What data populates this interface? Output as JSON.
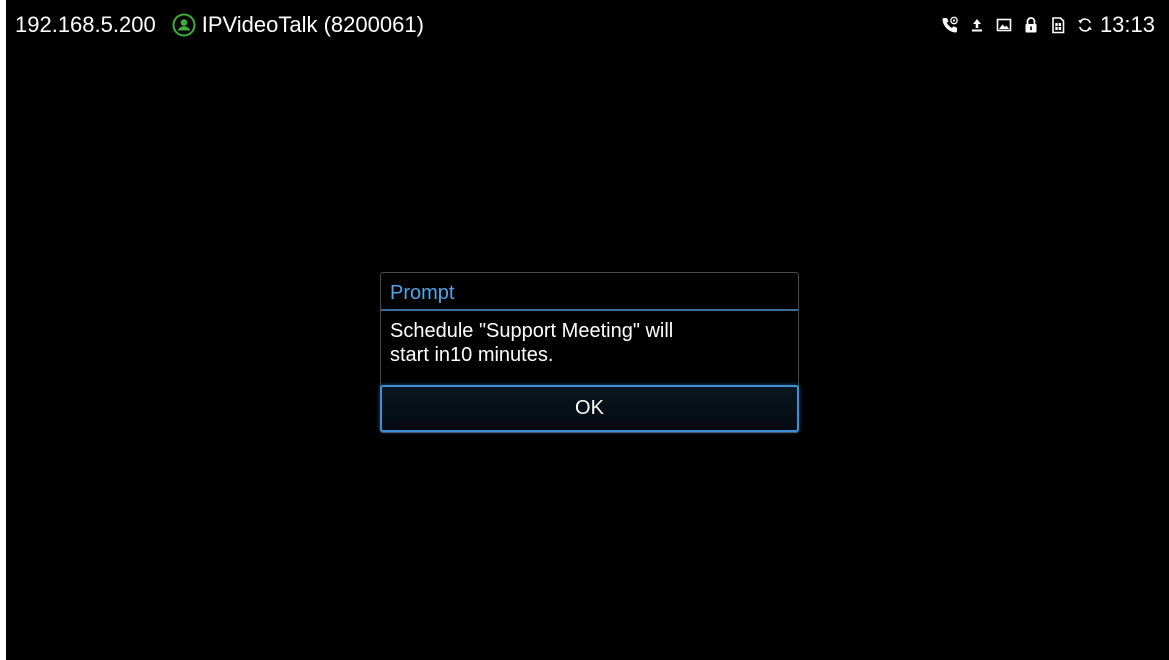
{
  "status_bar": {
    "ip_address": "192.168.5.200",
    "account_name": "IPVideoTalk (8200061)",
    "account_status_color": "#3fae3f",
    "icons": [
      "call-forward-icon",
      "upload-icon",
      "image-icon",
      "lock-icon",
      "sim-card-icon",
      "sync-icon"
    ],
    "time": "13:13"
  },
  "dialog": {
    "title": "Prompt",
    "message_line1": "Schedule \"Support Meeting\" will",
    "message_line2": "start in10 minutes.",
    "ok_label": "OK",
    "accent_color": "#4fa6e8"
  }
}
